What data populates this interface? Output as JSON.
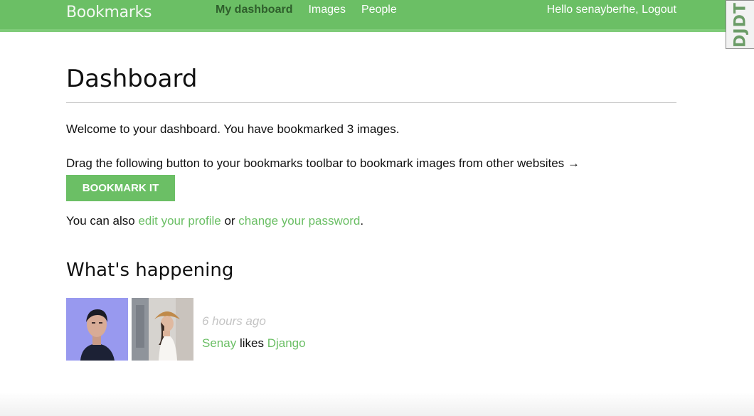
{
  "header": {
    "logo": "Bookmarks",
    "nav": [
      {
        "label": "My dashboard",
        "active": true
      },
      {
        "label": "Images",
        "active": false
      },
      {
        "label": "People",
        "active": false
      }
    ],
    "greeting": "Hello senayberhe,",
    "logout_label": "Logout",
    "accent_color": "#6bbf65"
  },
  "debug_toolbar": {
    "label": "DJDT"
  },
  "main": {
    "title": "Dashboard",
    "welcome_text": "Welcome to your dashboard. You have bookmarked 3 images.",
    "drag_text": "Drag the following button to your bookmarks toolbar to bookmark images from other websites →",
    "bookmark_button_label": "BOOKMARK IT",
    "also_prefix": "You can also",
    "edit_profile_link": "edit your profile",
    "also_middle": "or",
    "change_password_link": "change your password",
    "also_suffix": "."
  },
  "activity": {
    "heading": "What's happening",
    "items": [
      {
        "timestamp": "6 hours ago",
        "user": "Senay",
        "verb": "likes",
        "target": "Django"
      }
    ]
  }
}
